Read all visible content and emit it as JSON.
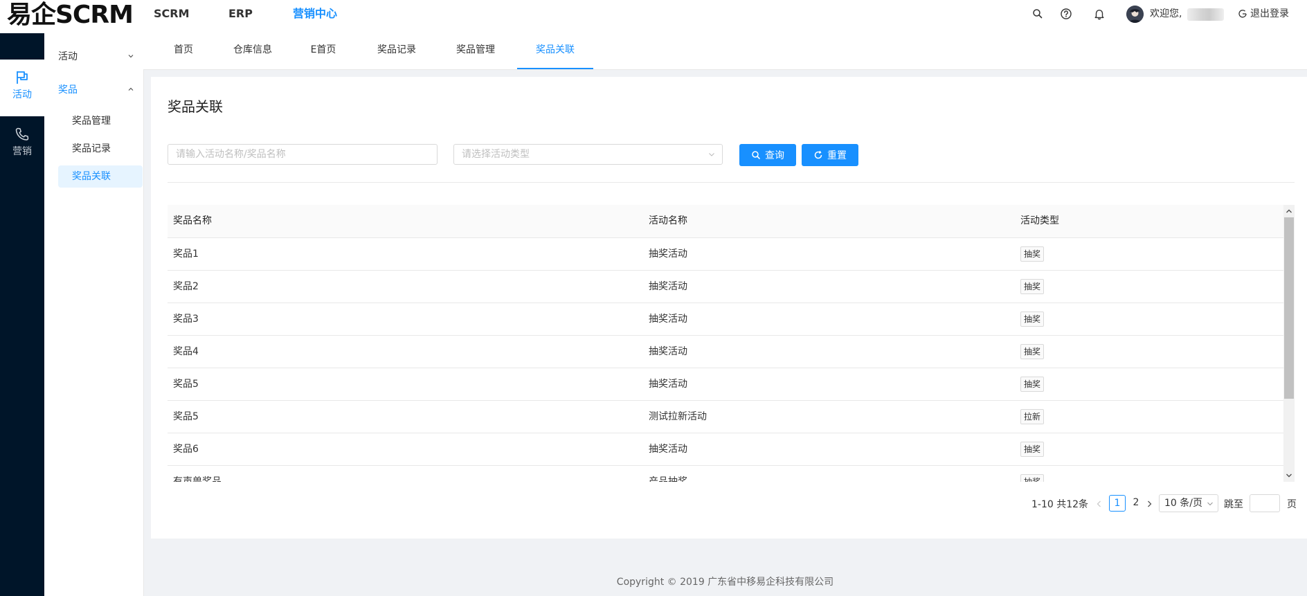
{
  "header": {
    "logo": "易企SCRM",
    "nav": [
      {
        "label": "SCRM",
        "active": false
      },
      {
        "label": "ERP",
        "active": false
      },
      {
        "label": "营销中心",
        "active": true
      }
    ],
    "welcome": "欢迎您,",
    "logout": "退出登录",
    "icons": [
      "search-icon",
      "help-icon",
      "bell-icon"
    ]
  },
  "rail": [
    {
      "label": "活动",
      "icon": "flag-icon",
      "active": true
    },
    {
      "label": "营销",
      "icon": "phone-icon",
      "active": false
    }
  ],
  "sidebar": {
    "groups": [
      {
        "label": "活动",
        "expanded": false
      },
      {
        "label": "奖品",
        "expanded": true,
        "items": [
          "奖品管理",
          "奖品记录",
          "奖品关联"
        ]
      }
    ],
    "active_item": "奖品关联"
  },
  "tabs": [
    "首页",
    "仓库信息",
    "E首页",
    "奖品记录",
    "奖品管理",
    "奖品关联"
  ],
  "active_tab": "奖品关联",
  "page": {
    "title": "奖品关联",
    "search_placeholder": "请输入活动名称/奖品名称",
    "type_placeholder": "请选择活动类型",
    "query_button": "查询",
    "reset_button": "重置"
  },
  "table": {
    "columns": [
      "奖品名称",
      "活动名称",
      "活动类型"
    ],
    "rows": [
      {
        "prize": "奖品1",
        "activity": "抽奖活动",
        "type": "抽奖"
      },
      {
        "prize": "奖品2",
        "activity": "抽奖活动",
        "type": "抽奖"
      },
      {
        "prize": "奖品3",
        "activity": "抽奖活动",
        "type": "抽奖"
      },
      {
        "prize": "奖品4",
        "activity": "抽奖活动",
        "type": "抽奖"
      },
      {
        "prize": "奖品5",
        "activity": "抽奖活动",
        "type": "抽奖"
      },
      {
        "prize": "奖品5",
        "activity": "测试拉新活动",
        "type": "拉新"
      },
      {
        "prize": "奖品6",
        "activity": "抽奖活动",
        "type": "抽奖"
      },
      {
        "prize": "有声兽奖品",
        "activity": "产品抽奖",
        "type": "抽奖"
      }
    ]
  },
  "pagination": {
    "total_text": "1-10 共12条",
    "pages": [
      "1",
      "2"
    ],
    "current": "1",
    "page_size": "10 条/页",
    "jump_label": "跳至",
    "jump_unit": "页"
  },
  "footer": "Copyright © 2019 广东省中移易企科技有限公司",
  "colors": {
    "primary": "#1890ff",
    "rail_bg": "#001529",
    "page_bg": "#f0f2f5"
  }
}
